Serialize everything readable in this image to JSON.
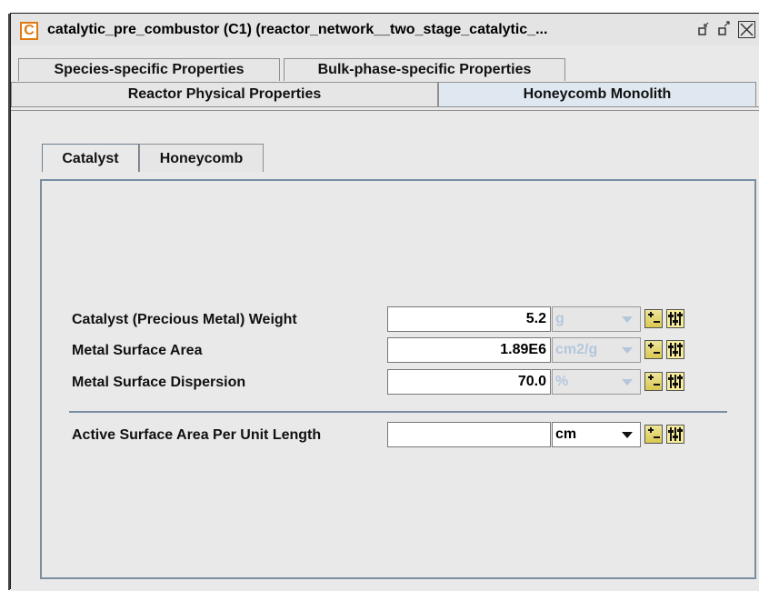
{
  "window": {
    "app_icon_letter": "C",
    "title": "catalytic_pre_combustor (C1)  (reactor_network__two_stage_catalytic_...",
    "buttons": {
      "restore": "restore",
      "maximize": "maximize",
      "close": "close"
    }
  },
  "top_tabs_row1": [
    {
      "label": "Species-specific Properties"
    },
    {
      "label": "Bulk-phase-specific Properties"
    }
  ],
  "top_tabs_row2": [
    {
      "label": "Reactor Physical Properties"
    },
    {
      "label": "Honeycomb Monolith",
      "selected": true
    }
  ],
  "inner_tabs": [
    {
      "label": "Catalyst",
      "selected": true
    },
    {
      "label": "Honeycomb"
    }
  ],
  "properties": [
    {
      "label": "Catalyst (Precious Metal) Weight",
      "value": "5.2",
      "unit": "g",
      "unit_enabled": false
    },
    {
      "label": "Metal Surface Area",
      "value": "1.89E6",
      "unit": "cm2/g",
      "unit_enabled": false
    },
    {
      "label": "Metal Surface Dispersion",
      "value": "70.0",
      "unit": "%",
      "unit_enabled": false
    },
    {
      "label": "Active Surface Area Per Unit Length",
      "value": "",
      "unit": "cm",
      "unit_enabled": true
    }
  ],
  "icons": {
    "app": "app-c-icon",
    "plus_minus": "plus-minus-icon",
    "settings": "parameter-settings-icon",
    "dropdown": "chevron-down-icon"
  },
  "colors": {
    "accent_orange": "#e07a10",
    "selected_tab": "#dfe8f1",
    "disabled_unit_text": "#b3c7dc",
    "panel_border": "#7a8ea2"
  }
}
